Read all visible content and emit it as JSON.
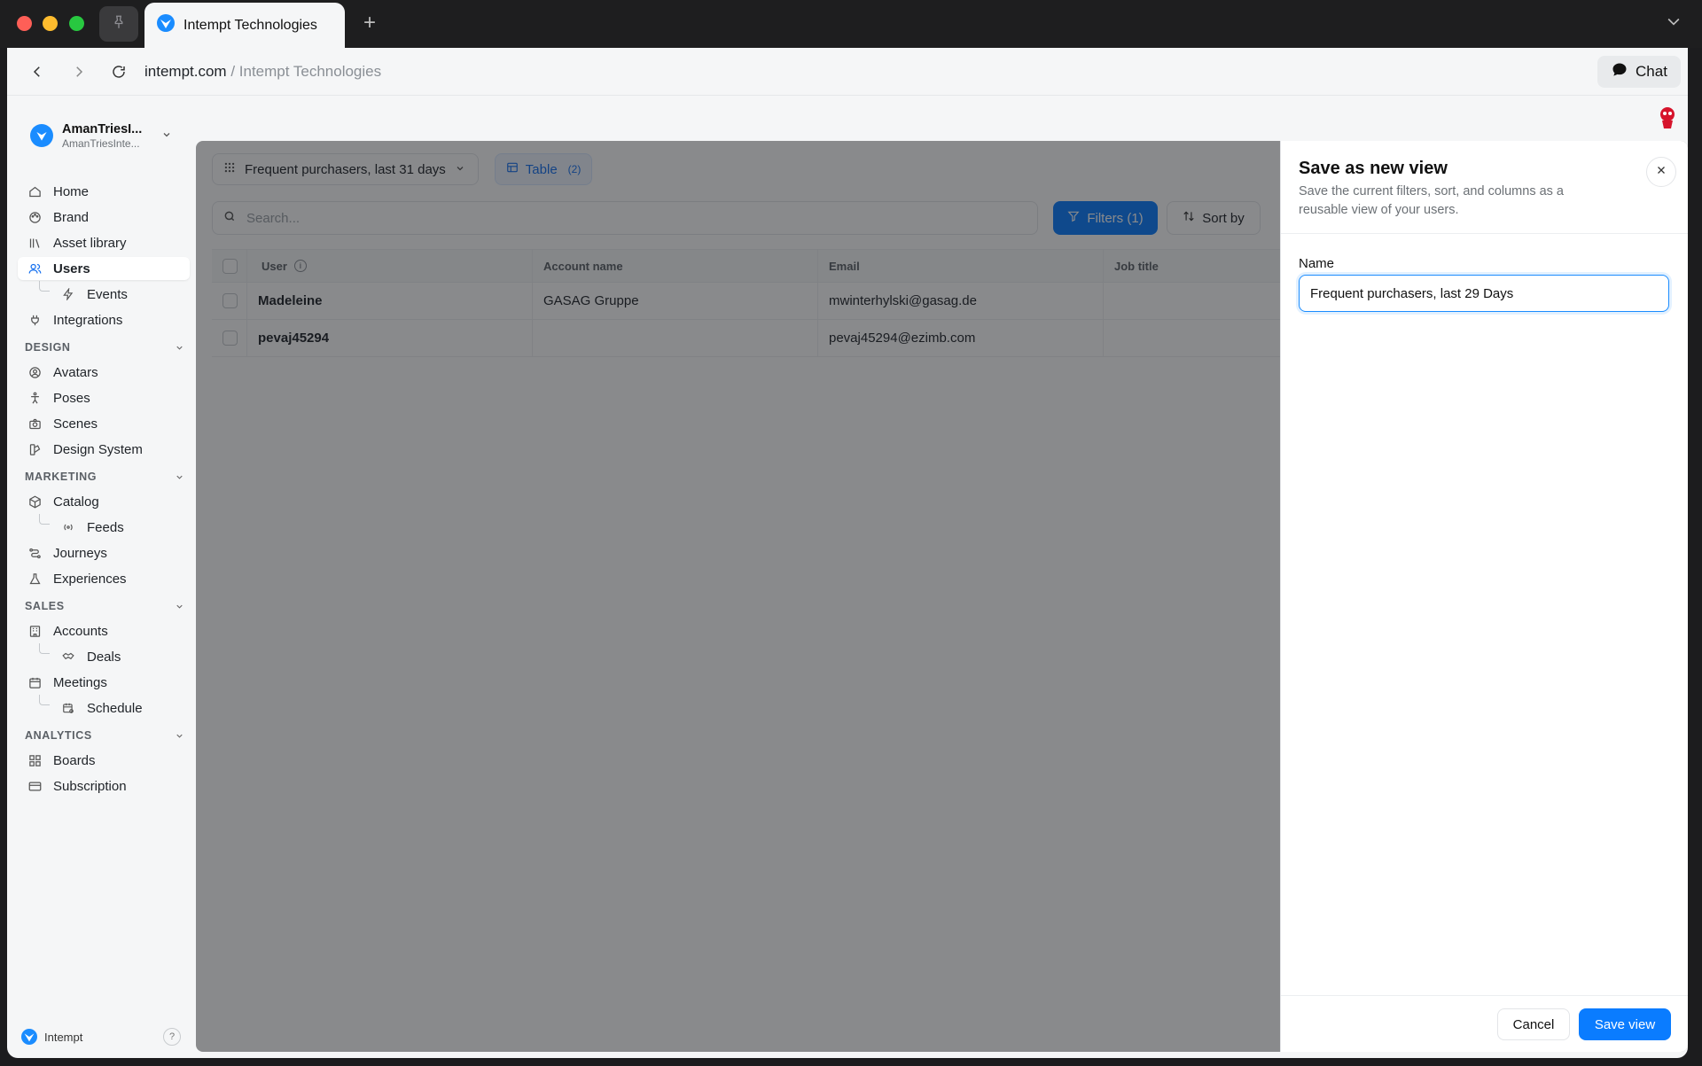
{
  "browser": {
    "tab_title": "Intempt Technologies",
    "new_tab": "+",
    "url_domain": "intempt.com",
    "url_rest": " / Intempt Technologies",
    "chat_label": "Chat"
  },
  "workspace": {
    "name": "AmanTriesI...",
    "sub": "AmanTriesInte..."
  },
  "sidebar": {
    "items": [
      {
        "label": "Home",
        "icon": "home-icon"
      },
      {
        "label": "Brand",
        "icon": "palette-icon"
      },
      {
        "label": "Asset library",
        "icon": "library-icon"
      },
      {
        "label": "Users",
        "icon": "users-icon",
        "active": true
      },
      {
        "label": "Events",
        "icon": "lightning-icon",
        "child": true
      },
      {
        "label": "Integrations",
        "icon": "plug-icon"
      }
    ],
    "design": {
      "title": "DESIGN",
      "items": [
        {
          "label": "Avatars",
          "icon": "avatar-icon"
        },
        {
          "label": "Poses",
          "icon": "pose-icon"
        },
        {
          "label": "Scenes",
          "icon": "camera-icon"
        },
        {
          "label": "Design System",
          "icon": "design-system-icon"
        }
      ]
    },
    "marketing": {
      "title": "MARKETING",
      "items": [
        {
          "label": "Catalog",
          "icon": "cube-icon"
        },
        {
          "label": "Feeds",
          "icon": "broadcast-icon",
          "child": true
        },
        {
          "label": "Journeys",
          "icon": "journey-icon"
        },
        {
          "label": "Experiences",
          "icon": "flask-icon"
        }
      ]
    },
    "sales": {
      "title": "SALES",
      "items": [
        {
          "label": "Accounts",
          "icon": "building-icon"
        },
        {
          "label": "Deals",
          "icon": "handshake-icon",
          "child": true
        },
        {
          "label": "Meetings",
          "icon": "calendar-icon"
        },
        {
          "label": "Schedule",
          "icon": "calendar-clock-icon",
          "child": true
        }
      ]
    },
    "analytics": {
      "title": "ANALYTICS",
      "items": [
        {
          "label": "Boards",
          "icon": "grid-icon"
        },
        {
          "label": "Subscription",
          "icon": "card-icon"
        }
      ]
    },
    "footer": {
      "label": "Intempt",
      "help": "?"
    }
  },
  "main": {
    "view_select": "Frequent purchasers, last 31 days",
    "view_tab": "Table",
    "view_tab_count": "(2)",
    "search_placeholder": "Search...",
    "filters_label": "Filters (1)",
    "sort_label": "Sort by",
    "columns": [
      "User",
      "Account name",
      "Email",
      "Job title"
    ],
    "rows": [
      {
        "user": "Madeleine",
        "account": "GASAG Gruppe",
        "email": "mwinterhylski@gasag.de",
        "job": ""
      },
      {
        "user": "pevaj45294",
        "account": "",
        "email": "pevaj45294@ezimb.com",
        "job": ""
      }
    ]
  },
  "drawer": {
    "title": "Save as new view",
    "description": "Save the current filters, sort, and columns as a reusable view of your users.",
    "name_label": "Name",
    "name_value": "Frequent purchasers, last 29 Days",
    "cancel_label": "Cancel",
    "save_label": "Save view"
  },
  "colors": {
    "accent": "#0a7cff",
    "overlay": "#141619"
  }
}
